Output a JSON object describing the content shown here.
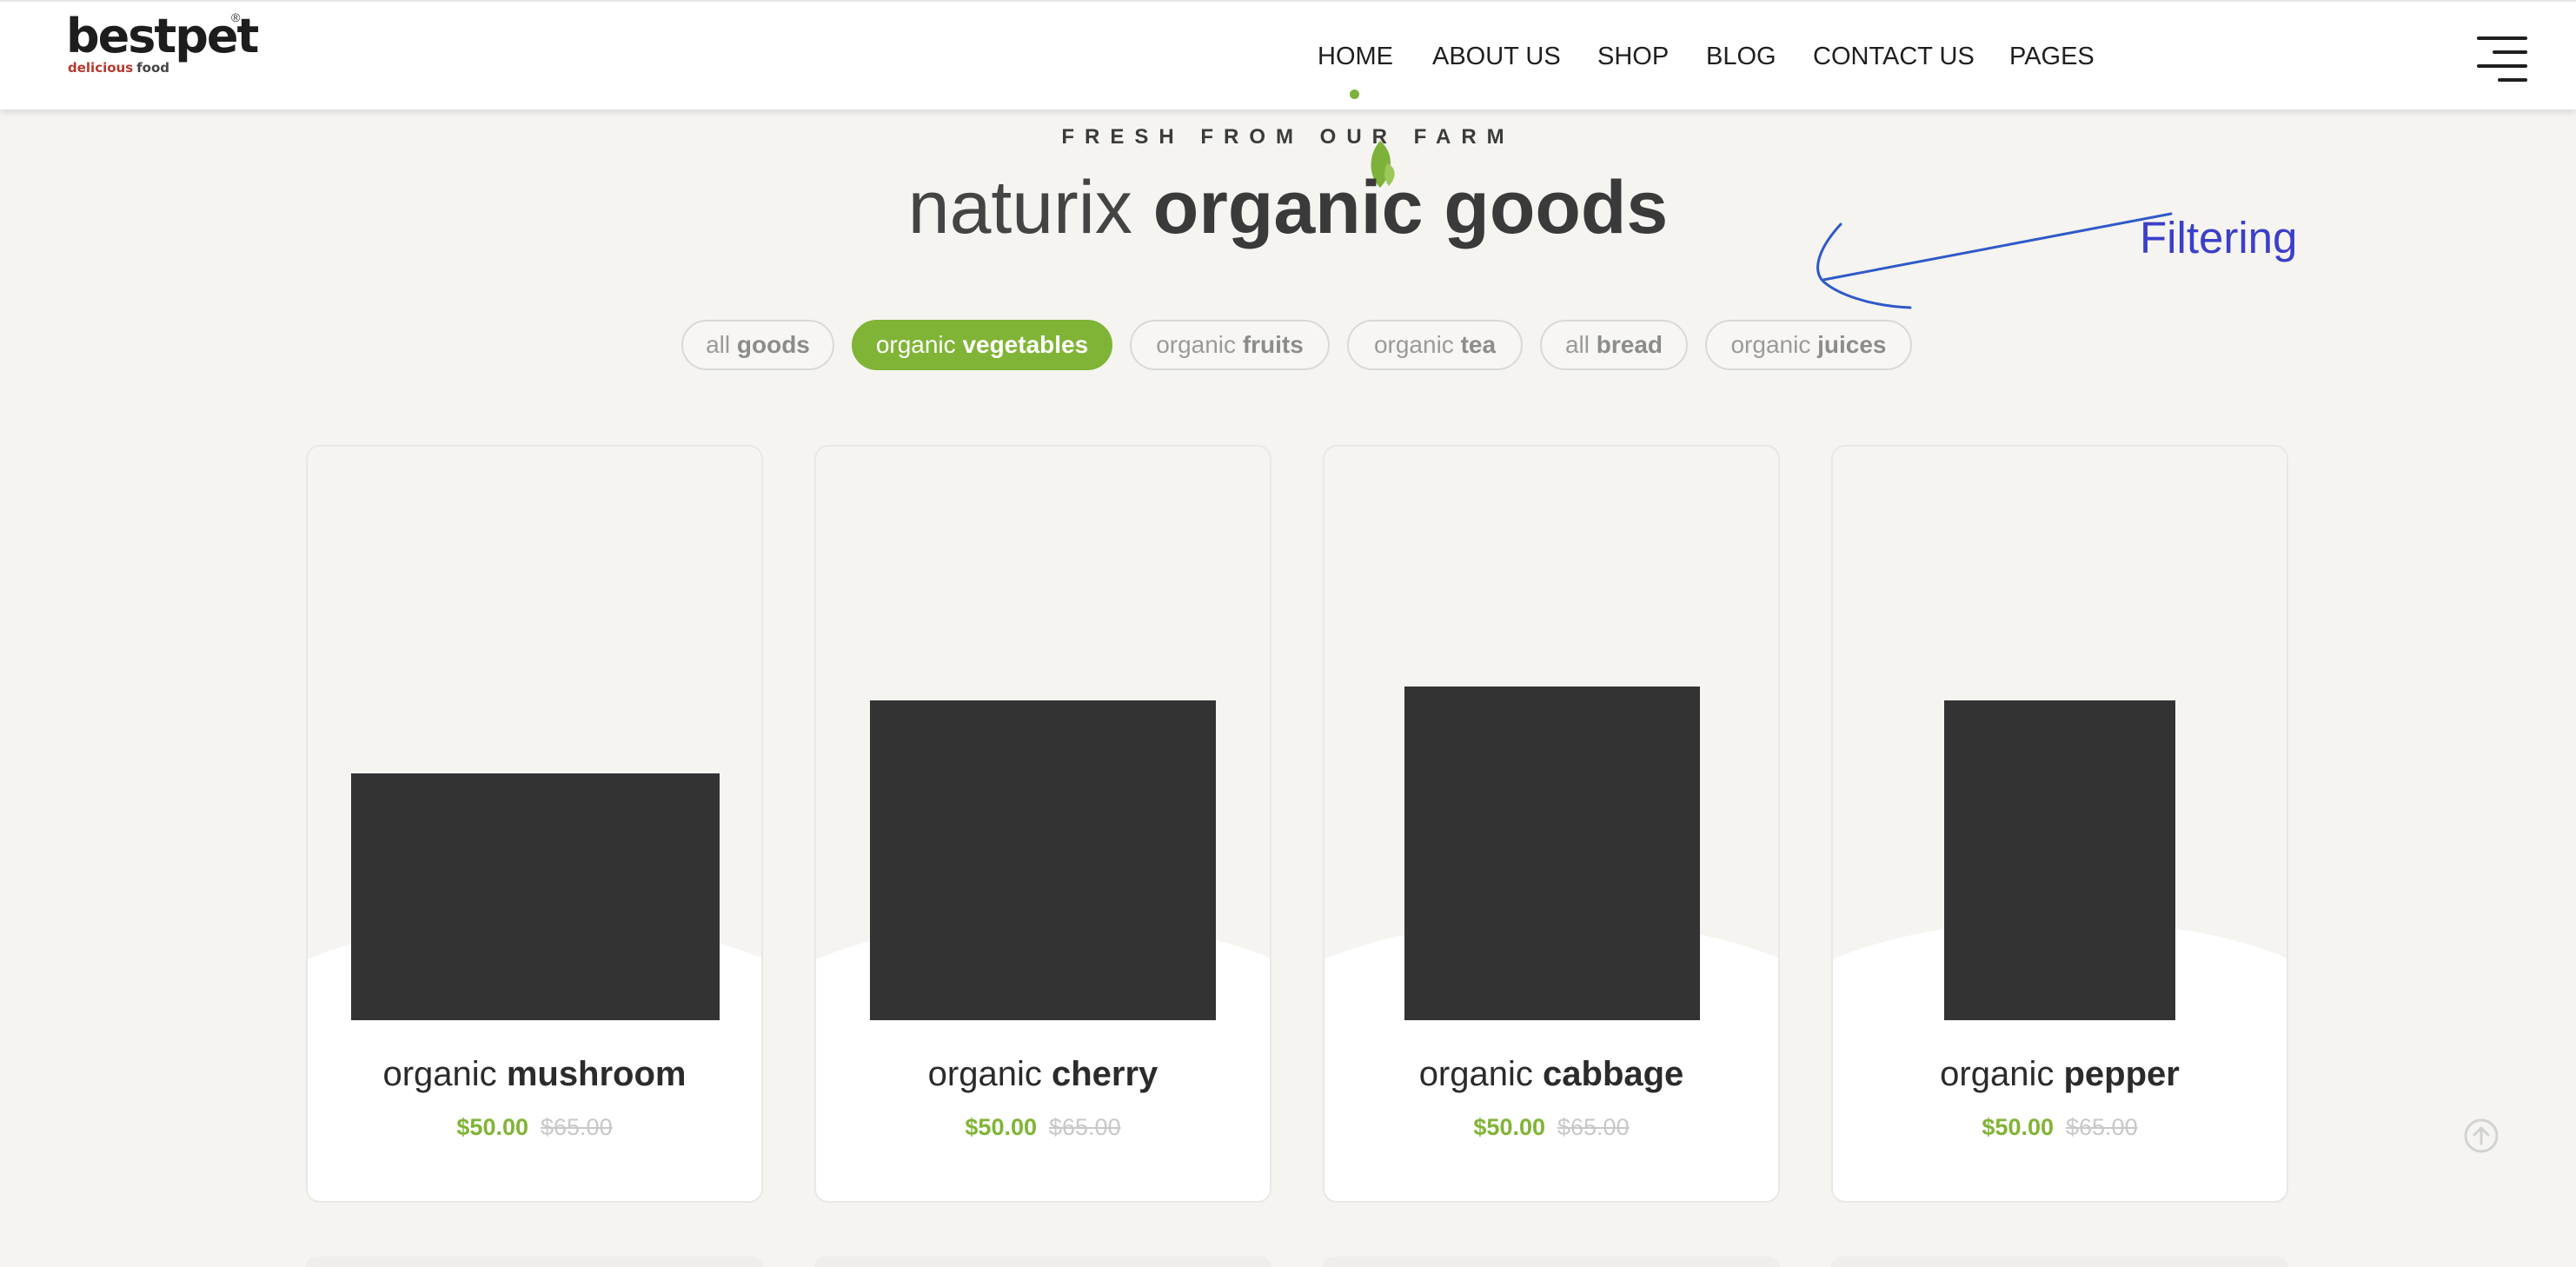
{
  "brand": {
    "name": "bestpet",
    "registered": "®",
    "tagline_part1": "delicious",
    "tagline_part2": "food"
  },
  "nav": {
    "items": [
      {
        "label": "HOME",
        "active": true
      },
      {
        "label": "ABOUT US"
      },
      {
        "label": "SHOP"
      },
      {
        "label": "BLOG"
      },
      {
        "label": "CONTACT US"
      },
      {
        "label": "PAGES"
      }
    ],
    "menu_icon": "hamburger-icon"
  },
  "section": {
    "kicker": "FRESH FROM OUR FARM",
    "title_light": "naturix",
    "title_bold": "organic goods",
    "leaf_icon": "leaf-icon"
  },
  "annotation": {
    "text": "Filtering",
    "color": "#3b3fc9"
  },
  "filters": [
    {
      "prefix": "all",
      "bold": "goods",
      "active": false
    },
    {
      "prefix": "organic",
      "bold": "vegetables",
      "active": true
    },
    {
      "prefix": "organic",
      "bold": "fruits",
      "active": false
    },
    {
      "prefix": "organic",
      "bold": "tea",
      "active": false
    },
    {
      "prefix": "all",
      "bold": "bread",
      "active": false
    },
    {
      "prefix": "organic",
      "bold": "juices",
      "active": false
    }
  ],
  "products": [
    {
      "prefix": "organic",
      "name": "mushroom",
      "price": "$50.00",
      "old_price": "$65.00"
    },
    {
      "prefix": "organic",
      "name": "cherry",
      "price": "$50.00",
      "old_price": "$65.00"
    },
    {
      "prefix": "organic",
      "name": "cabbage",
      "price": "$50.00",
      "old_price": "$65.00"
    },
    {
      "prefix": "organic",
      "name": "pepper",
      "price": "$50.00",
      "old_price": "$65.00"
    }
  ],
  "colors": {
    "accent": "#80b436",
    "background": "#f5f4f1",
    "image_placeholder": "#333333"
  },
  "scroll_top_icon": "arrow-up-circle-icon"
}
